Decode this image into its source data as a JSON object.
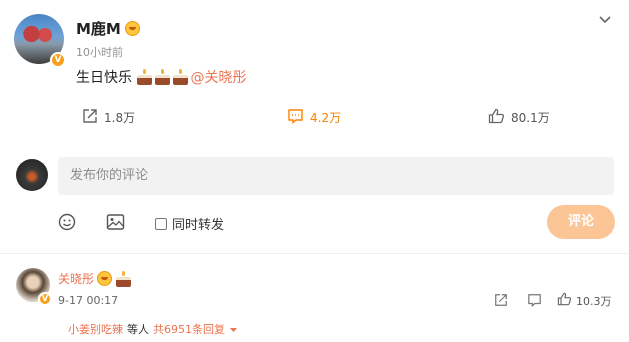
{
  "post": {
    "username": "M鹿M",
    "time": "10小时前",
    "text_prefix": "生日快乐",
    "mention": "@关晓彤",
    "actions": {
      "share": "1.8万",
      "comment": "4.2万",
      "like": "80.1万"
    }
  },
  "composer": {
    "placeholder": "发布你的评论",
    "repost_label": "同时转发",
    "submit_label": "评论"
  },
  "comment": {
    "username": "关晓彤",
    "time": "9-17 00:17",
    "like_count": "10.3万",
    "reply_user": "小姜别吃辣",
    "reply_mid": "等人",
    "reply_count": "共6951条回复"
  },
  "colors": {
    "accent": "#ff8200",
    "link": "#eb7350",
    "button_disabled": "#fcc595"
  },
  "icons": [
    "chevron-down-icon",
    "verified-badge-icon",
    "gold-medal-icon",
    "cake-emoji-icon",
    "share-icon",
    "comment-icon",
    "like-icon",
    "emoji-icon",
    "image-icon",
    "checkbox-icon",
    "caret-down-icon"
  ]
}
